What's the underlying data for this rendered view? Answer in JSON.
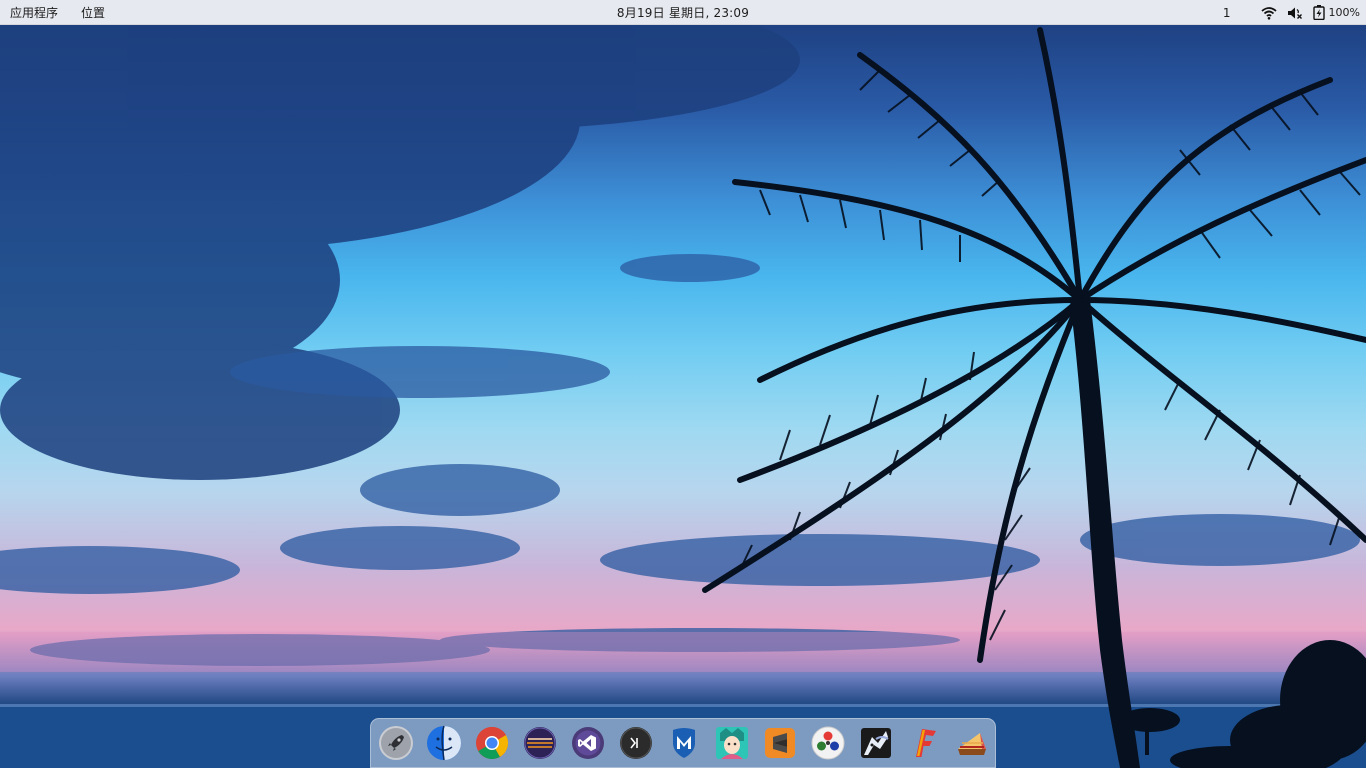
{
  "topbar": {
    "menu": {
      "applications": "应用程序",
      "places": "位置"
    },
    "clock": "8月19日 星期日, 23:09",
    "workspace": "1",
    "battery_percent": "100%",
    "status_icons": [
      "wifi-icon",
      "volume-muted-icon",
      "battery-charging-icon"
    ]
  },
  "dock": {
    "items": [
      {
        "name": "launchpad-rocket-icon"
      },
      {
        "name": "finder-icon"
      },
      {
        "name": "chrome-icon"
      },
      {
        "name": "eclipse-icon"
      },
      {
        "name": "visual-studio-icon"
      },
      {
        "name": "terminal-icon"
      },
      {
        "name": "malwarebytes-icon"
      },
      {
        "name": "anime-avatar-app-icon"
      },
      {
        "name": "sublime-text-icon"
      },
      {
        "name": "color-circles-app-icon"
      },
      {
        "name": "cow-app-icon"
      },
      {
        "name": "filezilla-icon"
      },
      {
        "name": "pie-app-icon"
      }
    ]
  },
  "colors": {
    "topbar_bg": "#eef0f4",
    "dock_bg": "#cddaeb"
  }
}
